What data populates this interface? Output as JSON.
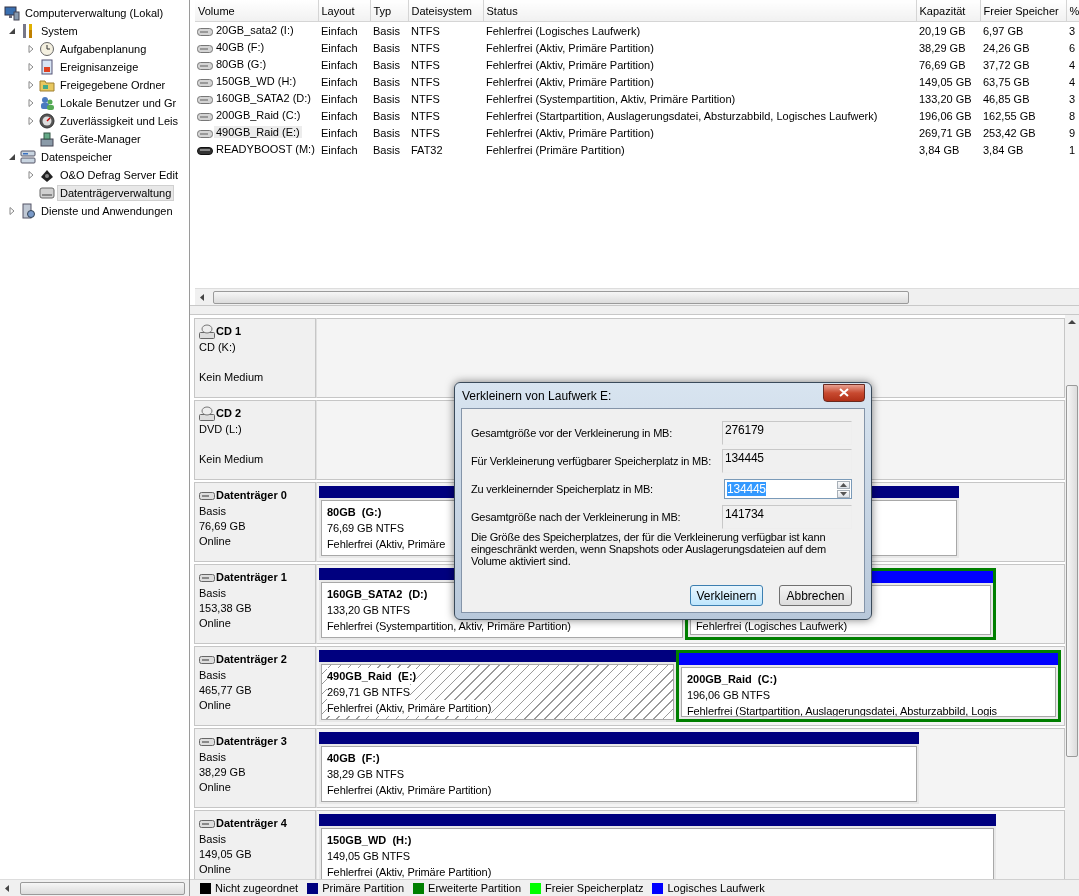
{
  "tree": {
    "items": [
      {
        "label": "Computerverwaltung (Lokal)",
        "selected": false,
        "children": [
          {
            "label": "System",
            "expanded": true,
            "selected": false,
            "children": [
              {
                "label": "Aufgabenplanung",
                "expanded": false,
                "selected": false
              },
              {
                "label": "Ereignisanzeige",
                "expanded": false,
                "selected": false
              },
              {
                "label": "Freigegebene Ordner",
                "expanded": false,
                "selected": false
              },
              {
                "label": "Lokale Benutzer und Gr",
                "expanded": false,
                "selected": false
              },
              {
                "label": "Zuverlässigkeit und Leis",
                "expanded": false,
                "selected": false
              },
              {
                "label": "Geräte-Manager",
                "selected": false
              }
            ]
          },
          {
            "label": "Datenspeicher",
            "expanded": true,
            "selected": false,
            "children": [
              {
                "label": "O&O Defrag Server Edit",
                "expanded": false,
                "selected": false
              },
              {
                "label": "Datenträgerverwaltung",
                "selected": true
              }
            ]
          },
          {
            "label": "Dienste und Anwendungen",
            "expanded": false,
            "selected": false
          }
        ]
      }
    ]
  },
  "table": {
    "columns": [
      "Volume",
      "Layout",
      "Typ",
      "Dateisystem",
      "Status",
      "Kapazität",
      "Freier Speicher",
      "%"
    ],
    "rows": [
      {
        "kind": "disk",
        "selected": false,
        "cells": [
          "20GB_sata2 (I:)",
          "Einfach",
          "Basis",
          "NTFS",
          "Fehlerfrei (Logisches Laufwerk)",
          "20,19 GB",
          "6,97 GB",
          "3"
        ]
      },
      {
        "kind": "disk",
        "selected": false,
        "cells": [
          "40GB (F:)",
          "Einfach",
          "Basis",
          "NTFS",
          "Fehlerfrei (Aktiv, Primäre Partition)",
          "38,29 GB",
          "24,26 GB",
          "6"
        ]
      },
      {
        "kind": "disk",
        "selected": false,
        "cells": [
          "80GB (G:)",
          "Einfach",
          "Basis",
          "NTFS",
          "Fehlerfrei (Aktiv, Primäre Partition)",
          "76,69 GB",
          "37,72 GB",
          "4"
        ]
      },
      {
        "kind": "disk",
        "selected": false,
        "cells": [
          "150GB_WD (H:)",
          "Einfach",
          "Basis",
          "NTFS",
          "Fehlerfrei (Aktiv, Primäre Partition)",
          "149,05 GB",
          "63,75 GB",
          "4"
        ]
      },
      {
        "kind": "disk",
        "selected": false,
        "cells": [
          "160GB_SATA2 (D:)",
          "Einfach",
          "Basis",
          "NTFS",
          "Fehlerfrei (Systempartition, Aktiv, Primäre Partition)",
          "133,20 GB",
          "46,85 GB",
          "3"
        ]
      },
      {
        "kind": "disk",
        "selected": false,
        "cells": [
          "200GB_Raid (C:)",
          "Einfach",
          "Basis",
          "NTFS",
          "Fehlerfrei (Startpartition, Auslagerungsdatei, Absturzabbild, Logisches Laufwerk)",
          "196,06 GB",
          "162,55 GB",
          "8"
        ]
      },
      {
        "kind": "disk",
        "selected": true,
        "cells": [
          "490GB_Raid (E:)",
          "Einfach",
          "Basis",
          "NTFS",
          "Fehlerfrei (Aktiv, Primäre Partition)",
          "269,71 GB",
          "253,42 GB",
          "9"
        ]
      },
      {
        "kind": "removable",
        "selected": false,
        "cells": [
          "READYBOOST (M:)",
          "Einfach",
          "Basis",
          "FAT32",
          "Fehlerfrei (Primäre Partition)",
          "3,84 GB",
          "3,84 GB",
          "1"
        ]
      }
    ]
  },
  "disks": [
    {
      "kind": "cd",
      "name": "CD 1",
      "drive": "CD (K:)",
      "status": "Kein Medium"
    },
    {
      "kind": "cd",
      "name": "CD 2",
      "drive": "DVD (L:)",
      "status": "Kein Medium"
    },
    {
      "kind": "disk",
      "name": "Datenträger 0",
      "type": "Basis",
      "size": "76,69 GB",
      "status": "Online",
      "partitions": [
        {
          "kind": "primary",
          "selected": false,
          "label": "80GB  (G:)",
          "detail": "76,69 GB NTFS",
          "status": "Fehlerfrei (Aktiv, Primäre"
        }
      ]
    },
    {
      "kind": "disk",
      "name": "Datenträger 1",
      "type": "Basis",
      "size": "153,38 GB",
      "status": "Online",
      "partitions": [
        {
          "kind": "primary",
          "selected": false,
          "label": "160GB_SATA2  (D:)",
          "detail": "133,20 GB NTFS",
          "status": "Fehlerfrei (Systempartition, Aktiv, Primäre Partition)"
        },
        {
          "kind": "logical",
          "selected": false,
          "status": "Fehlerfrei (Logisches Laufwerk)"
        }
      ]
    },
    {
      "kind": "disk",
      "name": "Datenträger 2",
      "type": "Basis",
      "size": "465,77 GB",
      "status": "Online",
      "partitions": [
        {
          "kind": "primary",
          "selected": true,
          "label": "490GB_Raid  (E:)",
          "detail": "269,71 GB NTFS",
          "status": "Fehlerfrei (Aktiv, Primäre Partition)"
        },
        {
          "kind": "logical",
          "selected": false,
          "label": "200GB_Raid  (C:)",
          "detail": "196,06 GB NTFS",
          "status": "Fehlerfrei (Startpartition, Auslagerungsdatei, Absturzabbild, Logis"
        }
      ]
    },
    {
      "kind": "disk",
      "name": "Datenträger 3",
      "type": "Basis",
      "size": "38,29 GB",
      "status": "Online",
      "partitions": [
        {
          "kind": "primary",
          "selected": false,
          "label": "40GB  (F:)",
          "detail": "38,29 GB NTFS",
          "status": "Fehlerfrei (Aktiv, Primäre Partition)"
        }
      ]
    },
    {
      "kind": "disk",
      "name": "Datenträger 4",
      "type": "Basis",
      "size": "149,05 GB",
      "status": "Online",
      "partitions": [
        {
          "kind": "primary",
          "selected": false,
          "label": "150GB_WD  (H:)",
          "detail": "149,05 GB NTFS",
          "status": "Fehlerfrei (Aktiv, Primäre Partition)"
        }
      ]
    }
  ],
  "legend": [
    {
      "label": "Nicht zugeordnet",
      "color": "#000000"
    },
    {
      "label": "Primäre Partition",
      "color": "#00007f"
    },
    {
      "label": "Erweiterte Partition",
      "color": "#007f00"
    },
    {
      "label": "Freier Speicherplatz",
      "color": "#00ff00"
    },
    {
      "label": "Logisches Laufwerk",
      "color": "#0000ff"
    }
  ],
  "dialog": {
    "title": "Verkleinern von Laufwerk E:",
    "fields": [
      {
        "kind": "readonly",
        "label": "Gesamtgröße vor der Verkleinerung in MB:",
        "value": "276179"
      },
      {
        "kind": "readonly",
        "label": "Für Verkleinerung verfügbarer Speicherplatz in MB:",
        "value": "134445"
      },
      {
        "kind": "spin",
        "label": "Zu verkleinernder Speicherplatz in MB:",
        "value": "134445",
        "text_selected": true
      },
      {
        "kind": "readonly",
        "label": "Gesamtgröße nach der Verkleinerung in MB:",
        "value": "141734"
      }
    ],
    "note": "Die Größe des Speicherplatzes, der für die Verkleinerung verfügbar ist kann eingeschränkt werden, wenn Snapshots oder Auslagerungsdateien auf dem Volume aktiviert sind.",
    "buttons": [
      {
        "label": "Verkleinern",
        "default": true
      },
      {
        "label": "Abbrechen",
        "default": false
      }
    ]
  }
}
